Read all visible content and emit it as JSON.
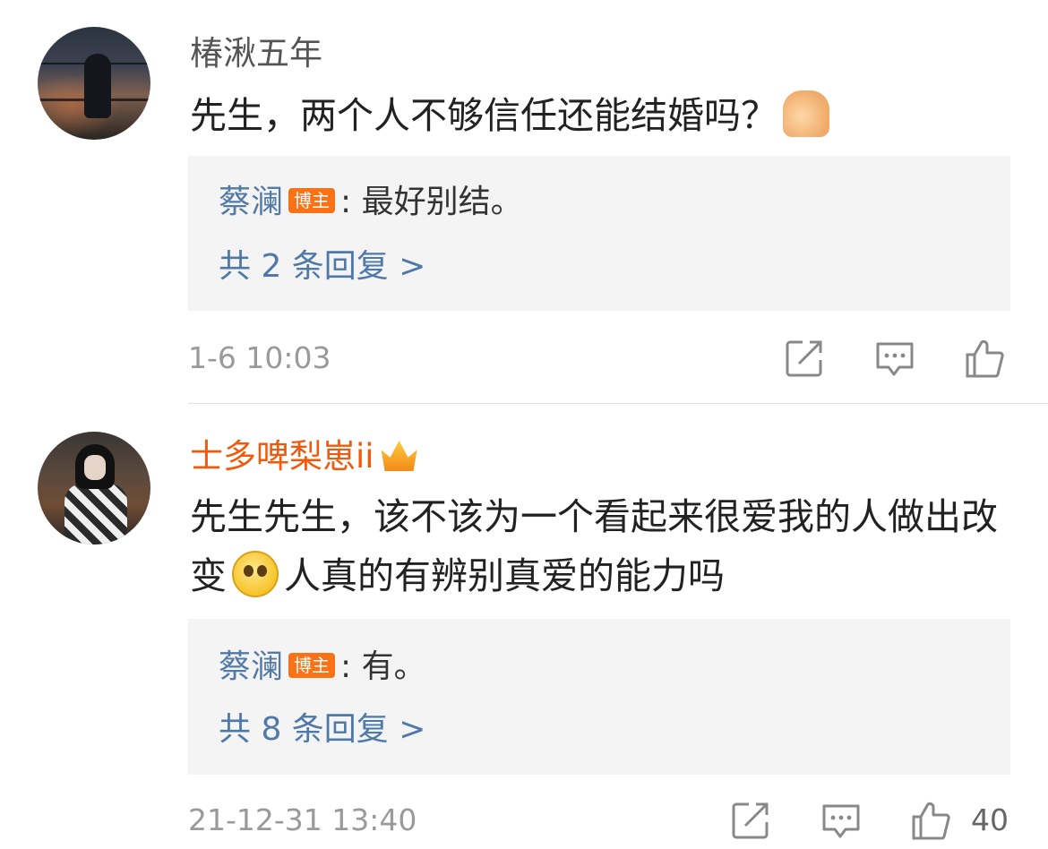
{
  "comments": [
    {
      "username": "椿湫五年",
      "text": "先生，两个人不够信任还能结婚吗？",
      "trailing_emoji": "hands-icon",
      "reply": {
        "author": "蔡澜",
        "badge": "博主",
        "separator": ":",
        "text": "最好别结。"
      },
      "more_replies": "共 2 条回复 >",
      "time": "1-6 10:03",
      "like_count": ""
    },
    {
      "username": "士多啤梨崽ii",
      "user_badge_icon": "crown-icon",
      "text_part1": "先生先生，该不该为一个看起来很爱我的人做出改变",
      "inline_emoji": "crying-face-icon",
      "text_part2": "人真的有辨别真爱的能力吗",
      "reply": {
        "author": "蔡澜",
        "badge": "博主",
        "separator": ":",
        "text": "有。"
      },
      "more_replies": "共 8 条回复 >",
      "time": "21-12-31 13:40",
      "like_count": "40"
    }
  ],
  "colors": {
    "reply_name": "#527aa6",
    "vip_username": "#f15a0d",
    "badge": "#f97316",
    "reply_bg": "#f4f4f4"
  }
}
